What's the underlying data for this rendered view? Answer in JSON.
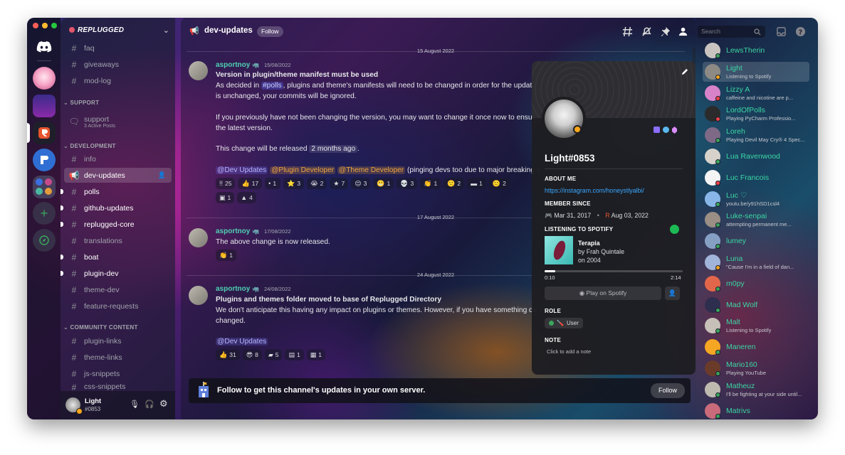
{
  "channel": {
    "name": "dev-updates",
    "follow_label": "Follow"
  },
  "search": {
    "placeholder": "Search"
  },
  "sidebar": {
    "server_name": "REPLUGGED",
    "top_channels": [
      "faq",
      "giveaways",
      "mod-log"
    ],
    "support_category": "SUPPORT",
    "support_forum": {
      "name": "support",
      "sub": "3 Active Posts"
    },
    "dev_category": "DEVELOPMENT",
    "dev_channels": [
      "info",
      "dev-updates",
      "polls",
      "github-updates",
      "replugged-core",
      "translations",
      "boat",
      "plugin-dev",
      "theme-dev",
      "feature-requests"
    ],
    "community_category": "COMMUNITY CONTENT",
    "community_channels": [
      "plugin-links",
      "theme-links",
      "js-snippets",
      "css-snippets"
    ]
  },
  "user_panel": {
    "name": "Light",
    "tag": "#0853"
  },
  "messages": [
    {
      "date": "15 August 2022",
      "author": "asportnoy",
      "time": "15/08/2022",
      "title": "Version in plugin/theme manifest must be used",
      "line1a": "As decided in ",
      "line1_mention": "#polls",
      "line1b": ", plugins and theme's manifests will need to be changed in order for the updat",
      "line2": "is unchanged, your commits will be ignored.",
      "line3": "If you previously have not been changing the version, you may want to change it once now to ensure",
      "line4": "the latest version.",
      "line5a": "This change will be released ",
      "line5_code": "2 months ago",
      "line5b": ".",
      "role1": "@Dev Updates",
      "role2": "@Plugin Developer",
      "role3": "@Theme Developer",
      "role_tail": "(pinging devs too due to major breaking c",
      "reactions": [
        {
          "icon": "!!",
          "count": "25"
        },
        {
          "icon": "👍",
          "count": "17"
        },
        {
          "icon": "•",
          "count": "1"
        },
        {
          "icon": "⭐",
          "count": "3"
        },
        {
          "icon": "😭",
          "count": "2"
        },
        {
          "icon": "★",
          "count": "7"
        },
        {
          "icon": "😌",
          "count": "3"
        },
        {
          "icon": "😬",
          "count": "1"
        },
        {
          "icon": "💀",
          "count": "3"
        },
        {
          "icon": "👏",
          "count": "1"
        },
        {
          "icon": "🙁",
          "count": "2"
        },
        {
          "icon": "▬",
          "count": "1"
        },
        {
          "icon": "🙂",
          "count": "2"
        }
      ],
      "reactions2": [
        {
          "icon": "▣",
          "count": "1"
        },
        {
          "icon": "▲",
          "count": "4"
        }
      ]
    },
    {
      "date": "17 August 2022",
      "author": "asportnoy",
      "time": "17/08/2022",
      "text": "The above change is now released.",
      "reactions": [
        {
          "icon": "👏",
          "count": "1"
        }
      ]
    },
    {
      "date": "24 August 2022",
      "author": "asportnoy",
      "time": "24/08/2022",
      "title": "Plugins and themes folder moved to base of Replugged Directory",
      "line1": "We don't anticipate this having any impact on plugins or themes. However, if you have something de",
      "line2": "changed.",
      "role1": "@Dev Updates",
      "reactions": [
        {
          "icon": "👍",
          "count": "31"
        },
        {
          "icon": "😎",
          "count": "8"
        },
        {
          "icon": "▰",
          "count": "5"
        },
        {
          "icon": "▤",
          "count": "1"
        },
        {
          "icon": "▦",
          "count": "1"
        }
      ]
    }
  ],
  "follow_banner": {
    "text": "Follow to get this channel's updates in your own server.",
    "button": "Follow"
  },
  "profile": {
    "username": "Light#0853",
    "about_title": "ABOUT ME",
    "about_link": "https://instagram.com/honeystlyalbi/",
    "member_title": "MEMBER SINCE",
    "member_discord": "Mar 31, 2017",
    "member_server": "Aug 03, 2022",
    "spotify_title": "LISTENING TO SPOTIFY",
    "track": "Terapia",
    "artist": "by Frah Quintale",
    "album": "on 2004",
    "elapsed": "0:10",
    "duration": "2:14",
    "progress": 0.075,
    "play_button": "Play on Spotify",
    "role_title": "ROLE",
    "role": "User",
    "note_title": "NOTE",
    "note_placeholder": "Click to add a note"
  },
  "members": [
    {
      "name": "LewsTherin",
      "activity": "",
      "status": "online",
      "color": "#3bd6a3",
      "avatar": "#c9c4c0"
    },
    {
      "name": "Light",
      "activity": "Listening to Spotify",
      "status": "idle",
      "color": "#3bd6a3",
      "avatar": "#8d8a85"
    },
    {
      "name": "Lizzy A",
      "activity": "caffeine and nicotine are p...",
      "status": "dnd",
      "color": "#3bd6a3",
      "avatar": "#d883c9"
    },
    {
      "name": "LordOfPolls",
      "activity": "Playing PyCharm Professio...",
      "status": "dnd",
      "color": "#3bd6a3",
      "avatar": "#2b2b2b"
    },
    {
      "name": "Loreh",
      "activity": "Playing Devil May Cry® 4 Spec...",
      "status": "online",
      "color": "#3bd6a3",
      "avatar": "#7e6a86"
    },
    {
      "name": "Lua Ravenwood",
      "activity": "",
      "status": "online",
      "color": "#3bd6a3",
      "avatar": "#d6d2cb"
    },
    {
      "name": "Luc Francois",
      "activity": "",
      "status": "dnd",
      "color": "#3bd6a3",
      "avatar": "#f4f4f4"
    },
    {
      "name": "Luc ♡",
      "activity": "youtu.be/y91hSD1csl4",
      "status": "online",
      "color": "#3bd6a3",
      "avatar": "#88b6e8"
    },
    {
      "name": "Luke-senpai",
      "activity": "attempting permanent me...",
      "status": "online",
      "color": "#3bd6a3",
      "avatar": "#9a8e85"
    },
    {
      "name": "lumey",
      "activity": "",
      "status": "online",
      "color": "#3bd6a3",
      "avatar": "#86a0c4"
    },
    {
      "name": "Luna",
      "activity": "\"Cause I'm in a field of dan...",
      "status": "idle",
      "color": "#3bd6a3",
      "avatar": "#a1b4d9"
    },
    {
      "name": "m0py",
      "activity": "",
      "status": "online",
      "color": "#3bd6a3",
      "avatar": "#e2674a"
    },
    {
      "name": "Mad Wolf",
      "activity": "",
      "status": "online",
      "color": "#3bd6a3",
      "avatar": "#2e2e4e"
    },
    {
      "name": "Malt",
      "activity": "Listening to Spotify",
      "status": "online",
      "color": "#3bd6a3",
      "avatar": "#c6c0b8"
    },
    {
      "name": "Maneren",
      "activity": "",
      "status": "online",
      "color": "#3bd6a3",
      "avatar": "#f5a623"
    },
    {
      "name": "Mario160",
      "activity": "Playing YouTube",
      "status": "online",
      "color": "#3bd6a3",
      "avatar": "#6b3b2a"
    },
    {
      "name": "Matheuz",
      "activity": "I'll be fighting at your side until...",
      "status": "online",
      "color": "#3bd6a3",
      "avatar": "#bfbab0"
    },
    {
      "name": "Matrivs",
      "activity": "",
      "status": "online",
      "color": "#3bd6a3",
      "avatar": "#c96b7a"
    }
  ]
}
